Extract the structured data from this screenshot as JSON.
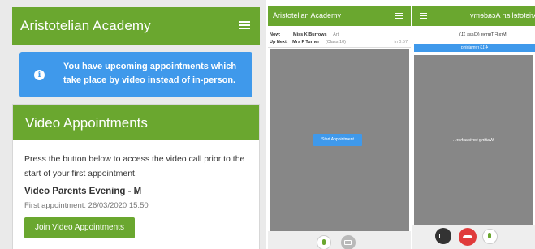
{
  "panel1": {
    "app_title": "Aristotelian Academy",
    "notice": "You have upcoming appointments which take place by video instead of in-person.",
    "card_title": "Video Appointments",
    "intro": "Press the button below to access the video call prior to the start of your first appointment.",
    "event_name": "Video Parents Evening - M",
    "first_appointment": "First appointment: 26/03/2020 15:50",
    "join_button": "Join Video Appointments"
  },
  "panel2": {
    "app_title": "Aristotelian Academy",
    "now_label": "Now:",
    "now_name": "Miss K Burrows",
    "now_subject": "Art",
    "next_label": "Up Next:",
    "next_name": "Mrs F Turner",
    "next_subject": "(Class 10)",
    "elapsed": "in 0:57",
    "start_button": "Start Appointment"
  },
  "panel3": {
    "app_title": "Aristotelian Academy",
    "teacher": "Mrs F Turner (Class 11)",
    "remaining": "4:13 remaining",
    "waiting": "Waiting for teacher..."
  },
  "colors": {
    "brand_green": "#6aa72f",
    "info_blue": "#3f99eb",
    "video_grey": "#878787",
    "hangup_red": "#e03b3b"
  }
}
